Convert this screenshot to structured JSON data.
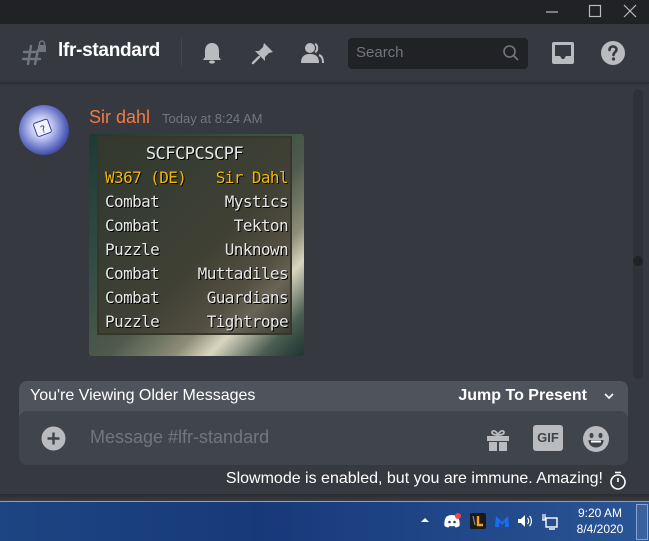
{
  "window": {
    "minimize_label": "—",
    "maximize_label": "☐",
    "close_label": "✕"
  },
  "header": {
    "channel_name": "lfr-standard",
    "channel_icon": "locked-text-channel-icon",
    "icons": [
      "notification-bell-icon",
      "pin-icon",
      "member-list-icon",
      "inbox-icon",
      "help-icon"
    ],
    "search_placeholder": "Search"
  },
  "message": {
    "author": "Sir dahl",
    "author_color": "#f47b3f",
    "timestamp": "Today at 8:24 AM",
    "attachment": {
      "title": "SCFCPCSCPF",
      "header_row": {
        "left": "W367 (DE)",
        "right": "Sir Dahl"
      },
      "rows": [
        {
          "left": "Combat",
          "right": "Mystics"
        },
        {
          "left": "Combat",
          "right": "Tekton"
        },
        {
          "left": "Puzzle",
          "right": "Unknown"
        },
        {
          "left": "Combat",
          "right": "Muttadiles"
        },
        {
          "left": "Combat",
          "right": "Guardians"
        },
        {
          "left": "Puzzle",
          "right": "Tightrope"
        }
      ]
    }
  },
  "older_messages_banner": {
    "text": "You're Viewing Older Messages",
    "jump_label": "Jump To Present"
  },
  "composer": {
    "placeholder": "Message #lfr-standard",
    "gif_label": "GIF"
  },
  "slowmode_text": "Slowmode is enabled, but you are immune. Amazing!",
  "taskbar": {
    "time": "9:20 AM",
    "date": "8/4/2020",
    "tray_icons": [
      "show-hidden-icons",
      "discord-icon",
      "game-app-icon",
      "malwarebytes-icon",
      "volume-icon",
      "network-icon"
    ]
  },
  "colors": {
    "background": "#36393f",
    "titlebar": "#202225",
    "accent_highlight": "#f2b70d"
  }
}
